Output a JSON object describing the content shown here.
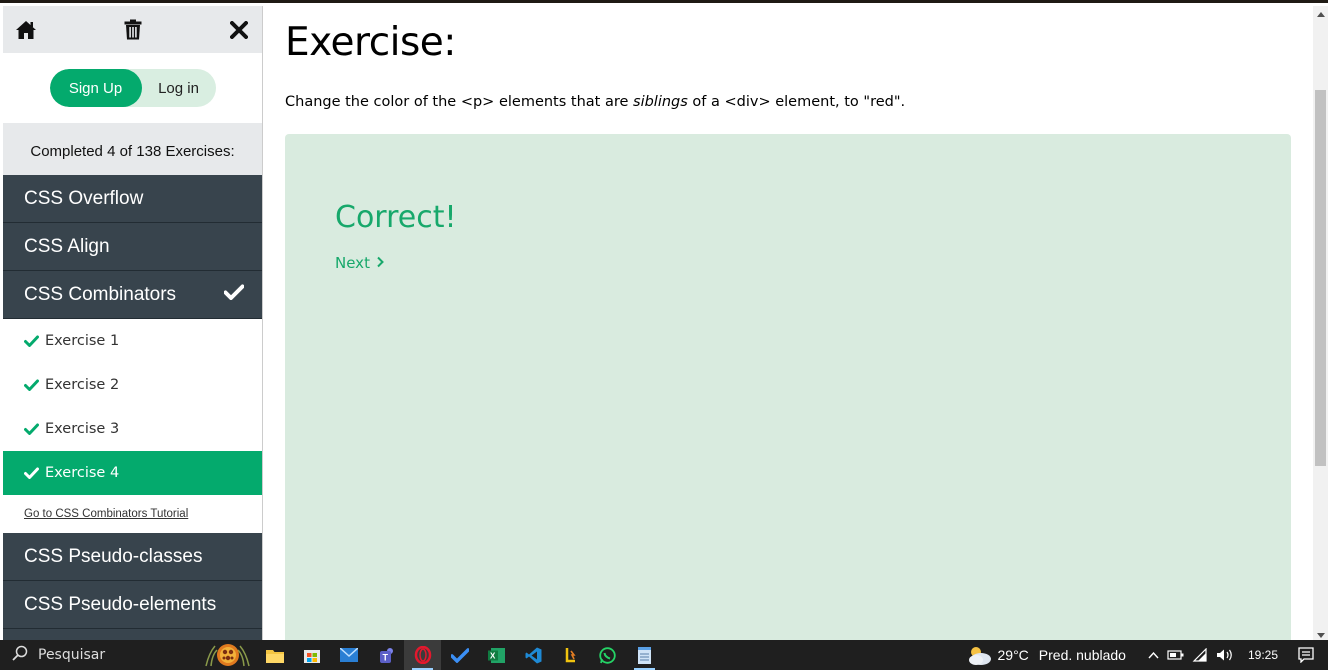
{
  "sidebar": {
    "auth": {
      "signup_label": "Sign Up",
      "login_label": "Log in"
    },
    "progress_text": "Completed 4 of 138 Exercises:",
    "topics_before": [
      {
        "label": "CSS Overflow"
      },
      {
        "label": "CSS Align"
      }
    ],
    "current_topic": {
      "label": "CSS Combinators",
      "completed": true
    },
    "exercises": [
      {
        "label": "Exercise 1",
        "done": true
      },
      {
        "label": "Exercise 2",
        "done": true
      },
      {
        "label": "Exercise 3",
        "done": true
      },
      {
        "label": "Exercise 4",
        "done": true,
        "active": true
      }
    ],
    "tutorial_link": "Go to CSS Combinators Tutorial",
    "topics_after": [
      {
        "label": "CSS Pseudo-classes"
      },
      {
        "label": "CSS Pseudo-elements"
      }
    ]
  },
  "main": {
    "title": "Exercise:",
    "instruction": {
      "part1": "Change the color of the <p> elements that are ",
      "emphasis": "siblings",
      "part2": " of a <div> element, to \"red\"."
    },
    "result": {
      "status": "Correct!",
      "next_label": "Next"
    }
  },
  "taskbar": {
    "search_placeholder": "Pesquisar",
    "apps": [
      "file-explorer",
      "store",
      "mail",
      "teams",
      "opera",
      "todo",
      "excel",
      "vscode",
      "winamp-like",
      "whatsapp",
      "notepad"
    ],
    "weather": {
      "temp": "29°C",
      "condition": "Pred. nublado"
    },
    "clock": "19:25"
  },
  "colors": {
    "accent": "#04aa6d",
    "topic_bg": "#38444d",
    "panel_bg": "#d9ebdf",
    "success_text": "#17a86b"
  }
}
